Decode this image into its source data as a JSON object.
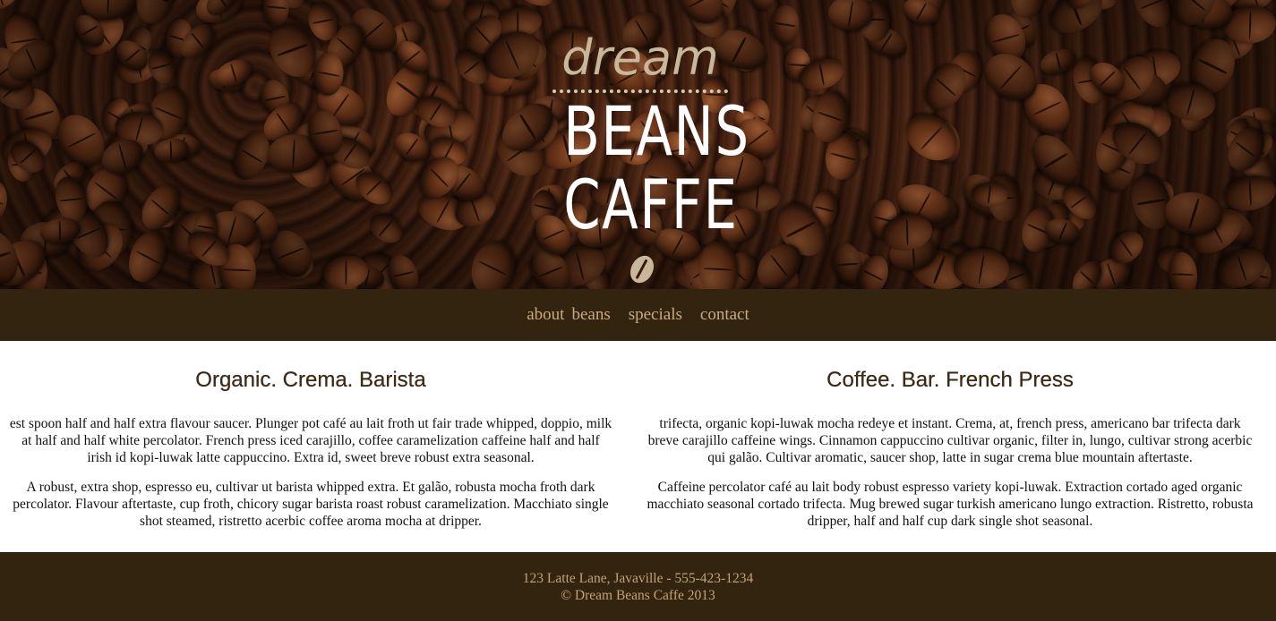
{
  "logo": {
    "line1": "dream",
    "line2": "BEANS",
    "line3": "CAFFE"
  },
  "nav": {
    "items": [
      {
        "label": "about"
      },
      {
        "label": "beans"
      },
      {
        "label": "specials"
      },
      {
        "label": "contact"
      }
    ]
  },
  "main": {
    "left": {
      "heading": "Organic. Crema. Barista",
      "paragraphs": [
        "est spoon half and half extra flavour saucer. Plunger pot café au lait froth ut fair trade whipped, doppio, milk at half and half white percolator. French press iced carajillo, coffee caramelization caffeine half and half irish id kopi-luwak latte cappuccino. Extra id, sweet breve robust extra seasonal.",
        "A robust, extra shop, espresso eu, cultivar ut barista whipped extra. Et galão, robusta mocha froth dark percolator. Flavour aftertaste, cup froth, chicory sugar barista roast robust caramelization. Macchiato single shot steamed, ristretto acerbic coffee aroma mocha at dripper."
      ]
    },
    "right": {
      "heading": "Coffee. Bar. French Press",
      "paragraphs": [
        "trifecta, organic kopi-luwak mocha redeye et instant. Crema, at, french press, americano bar trifecta dark breve carajillo caffeine wings. Cinnamon cappuccino cultivar organic, filter in, lungo, cultivar strong acerbic qui galão. Cultivar aromatic, saucer shop, latte in sugar crema blue mountain aftertaste.",
        "Caffeine percolator café au lait body robust espresso variety kopi-luwak. Extraction cortado aged organic macchiato seasonal cortado trifecta. Mug brewed sugar turkish americano lungo extraction. Ristretto, robusta dripper, half and half cup dark single shot seasonal."
      ]
    }
  },
  "footer": {
    "address": "123 Latte Lane, Javaville - 555-423-1234",
    "copyright": "© Dream Beans Caffe 2013"
  },
  "colors": {
    "nav_bg": "#33240f",
    "nav_link": "#c8ab82",
    "heading": "#3d2a16",
    "footer_text": "#c0a27a"
  }
}
